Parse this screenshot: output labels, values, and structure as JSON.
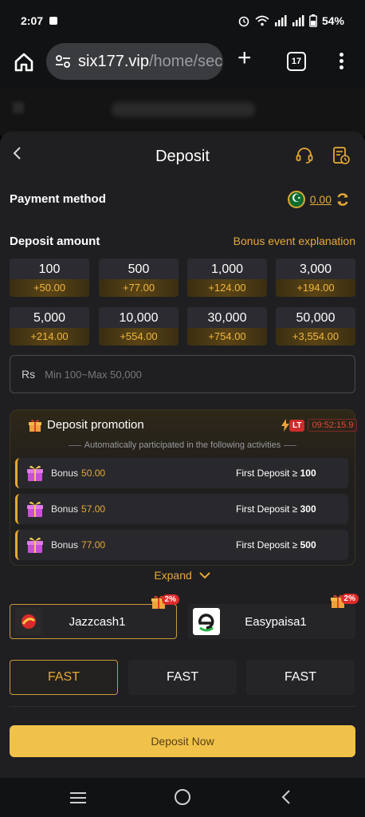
{
  "status": {
    "time": "2:07",
    "battery": "54%"
  },
  "browser": {
    "url_host": "six177.vip",
    "url_path": "/home/secu",
    "tab_count": "17"
  },
  "deposit": {
    "title": "Deposit",
    "payment_method_label": "Payment method",
    "balance": "0.00",
    "deposit_amount_label": "Deposit amount",
    "bonus_link": "Bonus event explanation",
    "amounts": [
      {
        "value": "100",
        "bonus": "+50.00"
      },
      {
        "value": "500",
        "bonus": "+77.00"
      },
      {
        "value": "1,000",
        "bonus": "+124.00"
      },
      {
        "value": "3,000",
        "bonus": "+194.00"
      },
      {
        "value": "5,000",
        "bonus": "+214.00"
      },
      {
        "value": "10,000",
        "bonus": "+554.00"
      },
      {
        "value": "30,000",
        "bonus": "+754.00"
      },
      {
        "value": "50,000",
        "bonus": "+3,554.00"
      }
    ],
    "currency": "Rs",
    "amount_placeholder": "Min 100~Max 50,000",
    "promotion": {
      "title": "Deposit promotion",
      "badge": "LT",
      "timer": "09:52:15.9",
      "subtitle": "Automatically participated in the following activities",
      "items": [
        {
          "label": "Bonus",
          "amount": "50.00",
          "condition": "First Deposit ≥ ",
          "threshold": "100"
        },
        {
          "label": "Bonus",
          "amount": "57.00",
          "condition": "First Deposit ≥ ",
          "threshold": "300"
        },
        {
          "label": "Bonus",
          "amount": "77.00",
          "condition": "First Deposit ≥ ",
          "threshold": "500"
        }
      ]
    },
    "expand_label": "Expand",
    "payment_options": [
      {
        "name": "Jazzcash1",
        "badge": "2%",
        "selected": true
      },
      {
        "name": "Easypaisa1",
        "badge": "2%",
        "selected": false
      }
    ],
    "channels": [
      "FAST",
      "FAST",
      "FAST"
    ],
    "deposit_button": "Deposit Now"
  },
  "colors": {
    "accent": "#e6a935",
    "button": "#f0c24a",
    "panel": "#1f1f22"
  }
}
